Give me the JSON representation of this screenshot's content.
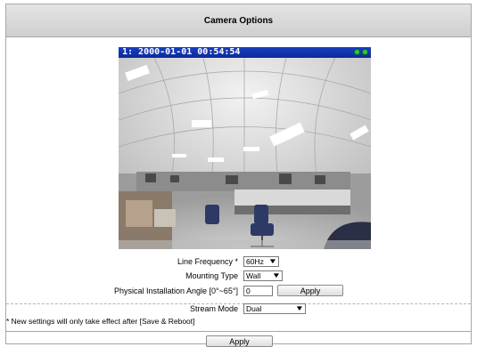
{
  "panel": {
    "title": "Camera Options"
  },
  "viewer": {
    "overlay_text": "1:  2000-01-01 00:54:54",
    "status_icons": [
      "status-led-icon",
      "status-led-icon"
    ]
  },
  "form": {
    "line_frequency": {
      "label": "Line Frequency *",
      "value": "60Hz"
    },
    "mounting_type": {
      "label": "Mounting Type",
      "value": "Wall"
    },
    "install_angle": {
      "label": "Physical Installation Angle  [0°~65°]",
      "value": "0",
      "apply_label": "Apply"
    },
    "stream_mode": {
      "label": "Stream Mode",
      "value": "Dual"
    }
  },
  "note": "* New settings will only take effect after [Save & Reboot]",
  "footer": {
    "apply_label": "Apply"
  }
}
